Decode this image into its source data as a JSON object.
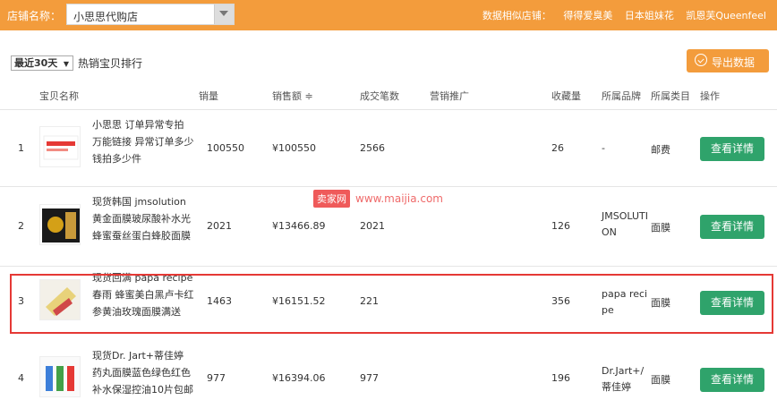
{
  "topbar": {
    "store_label": "店铺名称：",
    "store_value": "小思思代购店",
    "similar_label": "数据相似店铺：",
    "similar_stores": [
      "得得爱臭美",
      "日本姐妹花",
      "凯恩芙Queenfeel"
    ]
  },
  "toolbar": {
    "period": "最近30天",
    "rank_title": "热销宝贝排行",
    "export_label": "导出数据"
  },
  "columns": [
    "宝贝名称",
    "销量",
    "销售额 ≑",
    "成交笔数",
    "营销推广",
    "收藏量",
    "所属品牌",
    "所属类目",
    "操作"
  ],
  "rows": [
    {
      "index": "1",
      "name": "小思思 订单异常专拍 万能链接 异常订单多少钱拍多少件",
      "sales": "100550",
      "amount": "¥100550",
      "orders": "2566",
      "favorites": "26",
      "brand": "-",
      "category": "邮费",
      "action": "查看详情"
    },
    {
      "index": "2",
      "name": "现货韩国 jmsolution 黄金面膜玻尿酸补水光蜂蜜蚕丝蛋白蜂胶面膜",
      "sales": "2021",
      "amount": "¥13466.89",
      "orders": "2021",
      "favorites": "126",
      "brand": "JMSOLUTION",
      "category": "面膜",
      "action": "查看详情"
    },
    {
      "index": "3",
      "name": "现货回满 papa recipe 春雨 蜂蜜美白黑卢卡红参黄油玫瑰面膜满送",
      "sales": "1463",
      "amount": "¥16151.52",
      "orders": "221",
      "favorites": "356",
      "brand": "papa recipe",
      "category": "面膜",
      "action": "查看详情"
    },
    {
      "index": "4",
      "name": "现货Dr. Jart+蒂佳婷 药丸面膜蓝色绿色红色补水保湿控油10片包邮",
      "sales": "977",
      "amount": "¥16394.06",
      "orders": "977",
      "favorites": "196",
      "brand": "Dr.Jart+/蒂佳婷",
      "category": "面膜",
      "action": "查看详情"
    }
  ],
  "watermark": {
    "badge": "卖家网",
    "url": "www.maijia.com"
  },
  "colors": {
    "topbar": "#f39c3c",
    "button": "#2fa36b",
    "highlight": "#e53935"
  }
}
